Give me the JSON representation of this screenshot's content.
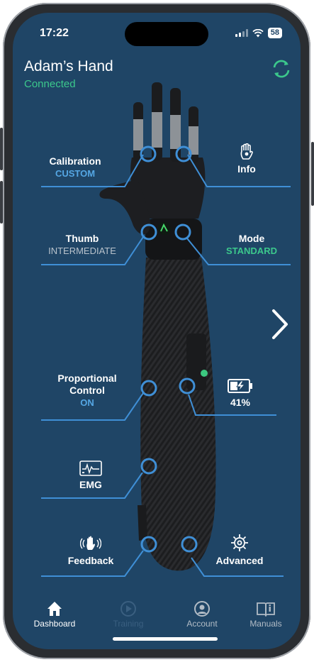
{
  "status": {
    "time": "17:22",
    "battery": "58"
  },
  "header": {
    "title": "Adam’s Hand",
    "connection": "Connected",
    "sync_icon": "sync-icon"
  },
  "controls": {
    "calibration": {
      "label": "Calibration",
      "value": "CUSTOM"
    },
    "info": {
      "label": "Info",
      "icon": "hand-info-icon"
    },
    "thumb": {
      "label": "Thumb",
      "value": "INTERMEDIATE"
    },
    "mode": {
      "label": "Mode",
      "value": "STANDARD"
    },
    "proportional": {
      "label_line1": "Proportional",
      "label_line2": "Control",
      "value": "ON"
    },
    "battery": {
      "value": "41%",
      "icon": "battery-charging-icon"
    },
    "emg": {
      "label": "EMG",
      "icon": "emg-signal-icon"
    },
    "feedback": {
      "label": "Feedback",
      "icon": "vibration-hand-icon"
    },
    "advanced": {
      "label": "Advanced",
      "icon": "gear-icon"
    }
  },
  "tabs": [
    {
      "label": "Dashboard",
      "icon": "home-icon"
    },
    {
      "label": "Training",
      "icon": "play-icon"
    },
    {
      "label": "Account",
      "icon": "account-icon"
    },
    {
      "label": "Manuals",
      "icon": "book-icon"
    }
  ],
  "colors": {
    "background": "#1f4566",
    "accent_blue": "#55a7e4",
    "accent_green": "#3cc88c",
    "line": "#3f8fd6"
  }
}
